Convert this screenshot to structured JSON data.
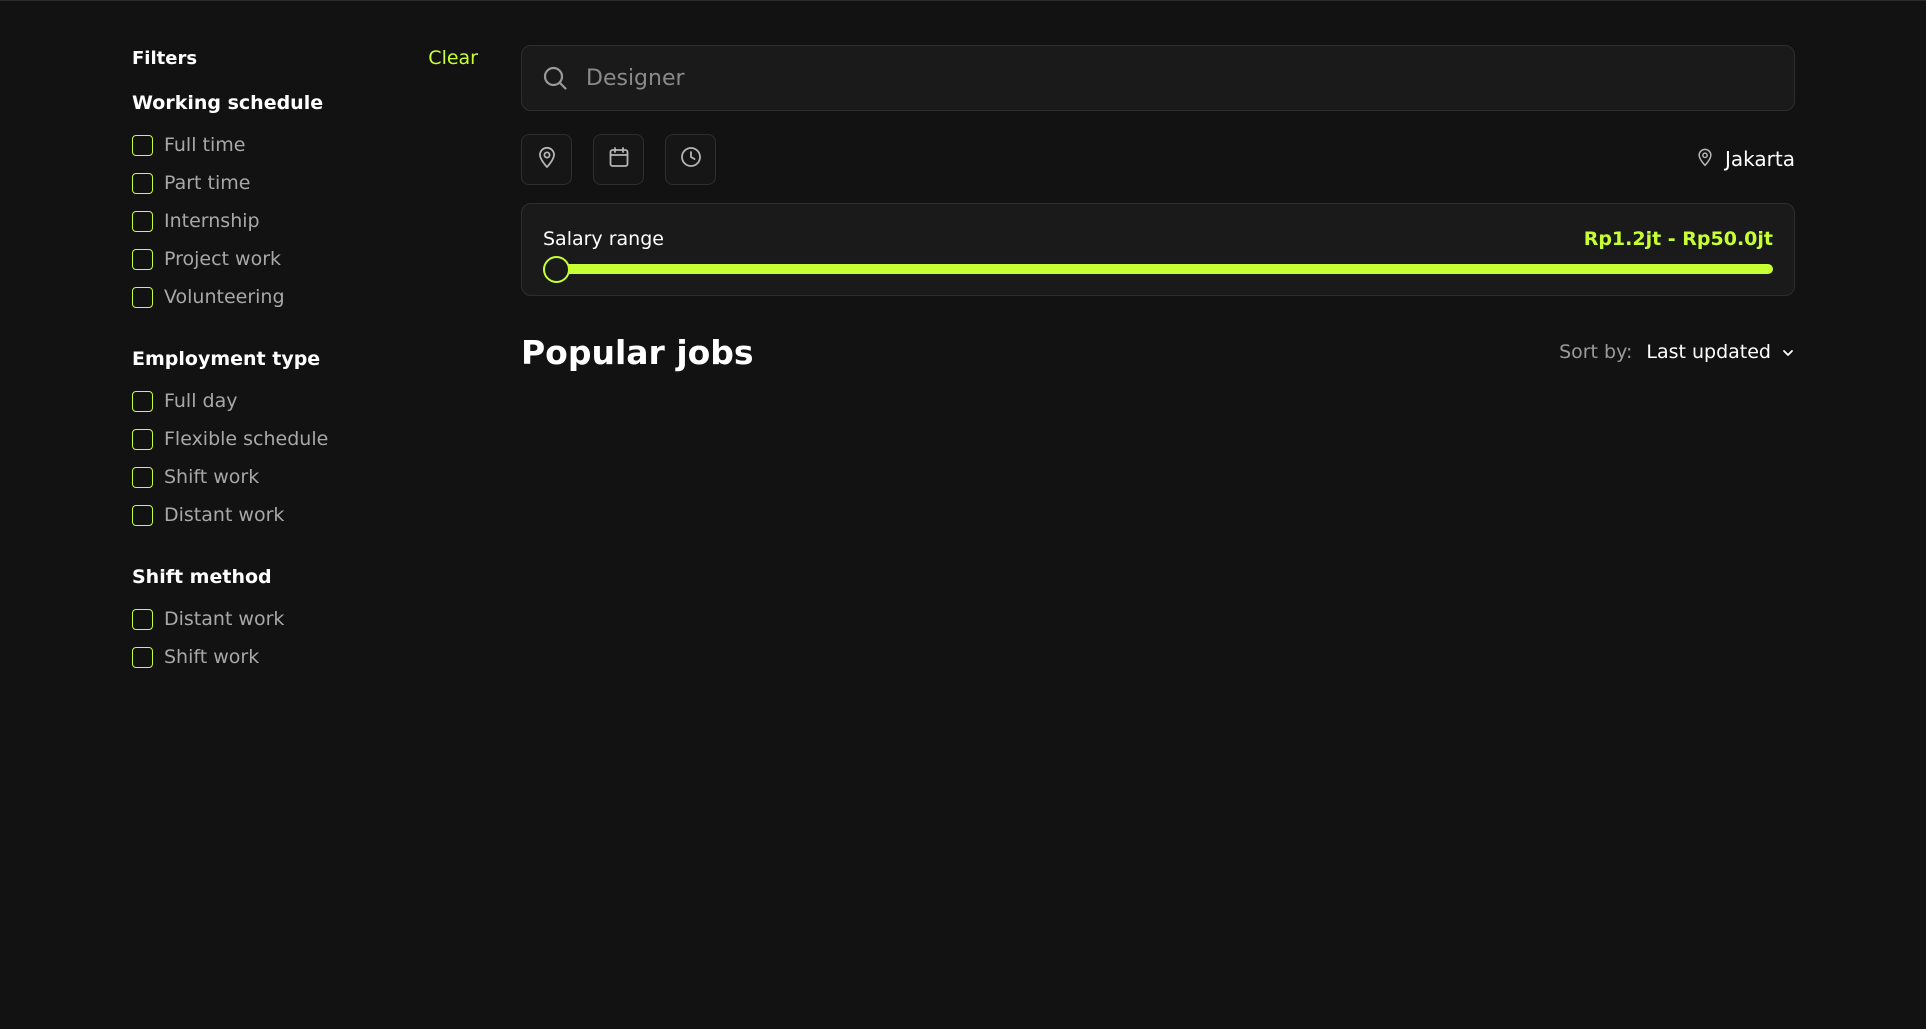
{
  "filters": {
    "title": "Filters",
    "clear_label": "Clear",
    "groups": [
      {
        "title": "Working schedule",
        "options": [
          "Full time",
          "Part time",
          "Internship",
          "Project work",
          "Volunteering"
        ]
      },
      {
        "title": "Employment type",
        "options": [
          "Full day",
          "Flexible schedule",
          "Shift work",
          "Distant work"
        ]
      },
      {
        "title": "Shift method",
        "options": [
          "Distant work",
          "Shift work"
        ]
      }
    ]
  },
  "search": {
    "placeholder": "Designer",
    "value": ""
  },
  "toolbar": {
    "icons": [
      "location-pin-icon",
      "calendar-icon",
      "clock-icon"
    ],
    "location_label": "Jakarta"
  },
  "salary": {
    "label": "Salary range",
    "value": "Rp1.2jt - Rp50.0jt",
    "slider_position": 0
  },
  "jobs": {
    "title": "Popular jobs",
    "sort_label": "Sort by:",
    "sort_value": "Last updated"
  },
  "colors": {
    "background": "#121212",
    "accent": "#c6ff33",
    "panel": "#1a1a1a",
    "border": "#2e2e2e",
    "muted_text": "#a8a8a8"
  }
}
